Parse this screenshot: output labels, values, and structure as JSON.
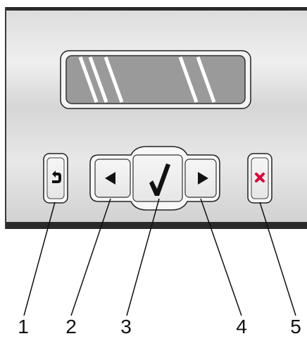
{
  "panel": {
    "body_color": "#d4d4d4",
    "display_color": "#9a9a9a",
    "cancel_color": "#e0003a"
  },
  "buttons": [
    {
      "id": "back",
      "icon": "back-arrow-icon"
    },
    {
      "id": "left",
      "icon": "triangle-left-icon"
    },
    {
      "id": "select",
      "icon": "checkmark-icon",
      "glyph": "✓"
    },
    {
      "id": "right",
      "icon": "triangle-right-icon"
    },
    {
      "id": "cancel",
      "icon": "x-cancel-icon",
      "glyph": "×"
    }
  ],
  "callouts": [
    {
      "number": "1",
      "target": "back"
    },
    {
      "number": "2",
      "target": "left"
    },
    {
      "number": "3",
      "target": "select"
    },
    {
      "number": "4",
      "target": "right"
    },
    {
      "number": "5",
      "target": "cancel"
    }
  ]
}
